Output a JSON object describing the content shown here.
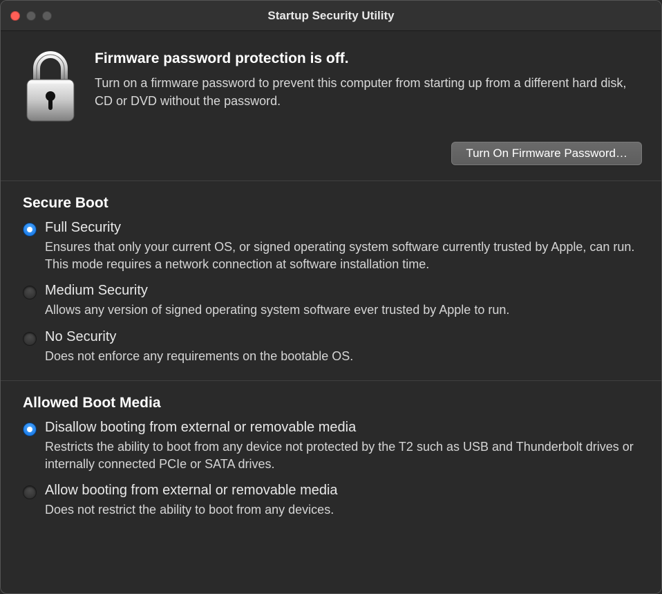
{
  "window": {
    "title": "Startup Security Utility"
  },
  "firmware": {
    "heading": "Firmware password protection is off.",
    "description": "Turn on a firmware password to prevent this computer from starting up from a different hard disk, CD or DVD without the password.",
    "button_label": "Turn On Firmware Password…"
  },
  "secure_boot": {
    "heading": "Secure Boot",
    "options": [
      {
        "label": "Full Security",
        "description": "Ensures that only your current OS, or signed operating system software currently trusted by Apple, can run. This mode requires a network connection at software installation time.",
        "checked": true
      },
      {
        "label": "Medium Security",
        "description": "Allows any version of signed operating system software ever trusted by Apple to run.",
        "checked": false
      },
      {
        "label": "No Security",
        "description": "Does not enforce any requirements on the bootable OS.",
        "checked": false
      }
    ]
  },
  "allowed_boot_media": {
    "heading": "Allowed Boot Media",
    "options": [
      {
        "label": "Disallow booting from external or removable media",
        "description": "Restricts the ability to boot from any device not protected by the T2 such as USB and Thunderbolt drives or internally connected PCIe or SATA drives.",
        "checked": true
      },
      {
        "label": "Allow booting from external or removable media",
        "description": "Does not restrict the ability to boot from any devices.",
        "checked": false
      }
    ]
  }
}
